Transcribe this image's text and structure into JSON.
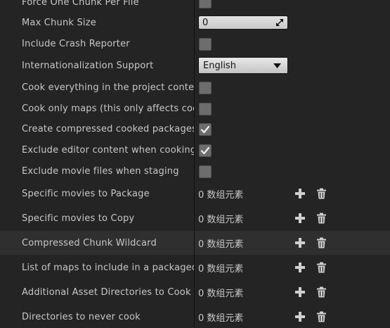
{
  "rows": [
    {
      "label": "Force One Chunk Per File",
      "type": "checkbox",
      "checked": false
    },
    {
      "label": "Max Chunk Size",
      "type": "number",
      "value": "0"
    },
    {
      "label": "Include Crash Reporter",
      "type": "checkbox",
      "checked": false
    },
    {
      "label": "Internationalization Support",
      "type": "dropdown",
      "value": "English"
    },
    {
      "label": "Cook everything in the project content",
      "type": "checkbox",
      "checked": false
    },
    {
      "label": "Cook only maps (this only affects cookall)",
      "type": "checkbox",
      "checked": false
    },
    {
      "label": "Create compressed cooked packages",
      "type": "checkbox",
      "checked": true
    },
    {
      "label": "Exclude editor content when cooking",
      "type": "checkbox",
      "checked": true
    },
    {
      "label": "Exclude movie files when staging",
      "type": "checkbox",
      "checked": false
    },
    {
      "label": "Specific movies to Package",
      "type": "array",
      "value": "0 数组元素"
    },
    {
      "label": "Specific movies to Copy",
      "type": "array",
      "value": "0 数组元素"
    },
    {
      "label": "Compressed Chunk Wildcard",
      "type": "array",
      "value": "0 数组元素"
    },
    {
      "label": "List of maps to include in a packaged build",
      "type": "array",
      "value": "0 数组元素"
    },
    {
      "label": "Additional Asset Directories to Cook",
      "type": "array",
      "value": "0 数组元素"
    },
    {
      "label": "Directories to never cook",
      "type": "array",
      "value": "0 数组元素"
    }
  ],
  "icons": {
    "add": "plus-icon",
    "delete": "trash-icon",
    "dropdown": "triangle-down-icon",
    "check": "checkmark-icon",
    "drag": "drag-arrows-icon"
  }
}
